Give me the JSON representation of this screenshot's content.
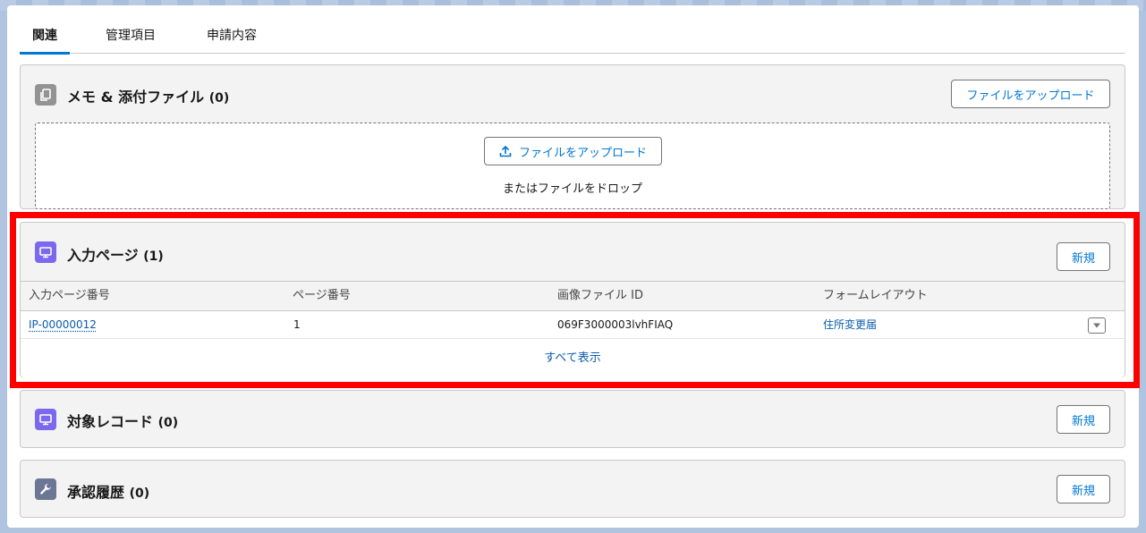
{
  "tabs": [
    {
      "label": "関連",
      "active": true
    },
    {
      "label": "管理項目",
      "active": false
    },
    {
      "label": "申請内容",
      "active": false
    }
  ],
  "notes_card": {
    "title": "メモ & 添付ファイル",
    "count": "(0)",
    "header_button": "ファイルをアップロード",
    "upload_button": "ファイルをアップロード",
    "drop_text": "またはファイルをドロップ",
    "icon": "file-copy-icon",
    "icon_color": "#939393"
  },
  "input_pages_card": {
    "title": "入力ページ",
    "count": "(1)",
    "new_button": "新規",
    "icon": "monitor-icon",
    "icon_color": "#7b68ee",
    "columns": [
      "入力ページ番号",
      "ページ番号",
      "画像ファイル ID",
      "フォームレイアウト"
    ],
    "rows": [
      {
        "id": "IP-00000012",
        "page_no": "1",
        "image_file_id": "069F3000003lvhFIAQ",
        "form_layout": "住所変更届"
      }
    ],
    "view_all": "すべて表示"
  },
  "target_records_card": {
    "title": "対象レコード",
    "count": "(0)",
    "new_button": "新規",
    "icon": "monitor-icon",
    "icon_color": "#7b68ee"
  },
  "approval_history_card": {
    "title": "承認履歴",
    "count": "(0)",
    "new_button": "新規",
    "icon": "wrench-icon",
    "icon_color": "#6b7794"
  },
  "colors": {
    "accent": "#0176d3",
    "link": "#0b5cab",
    "highlight_border": "#ff0000"
  }
}
